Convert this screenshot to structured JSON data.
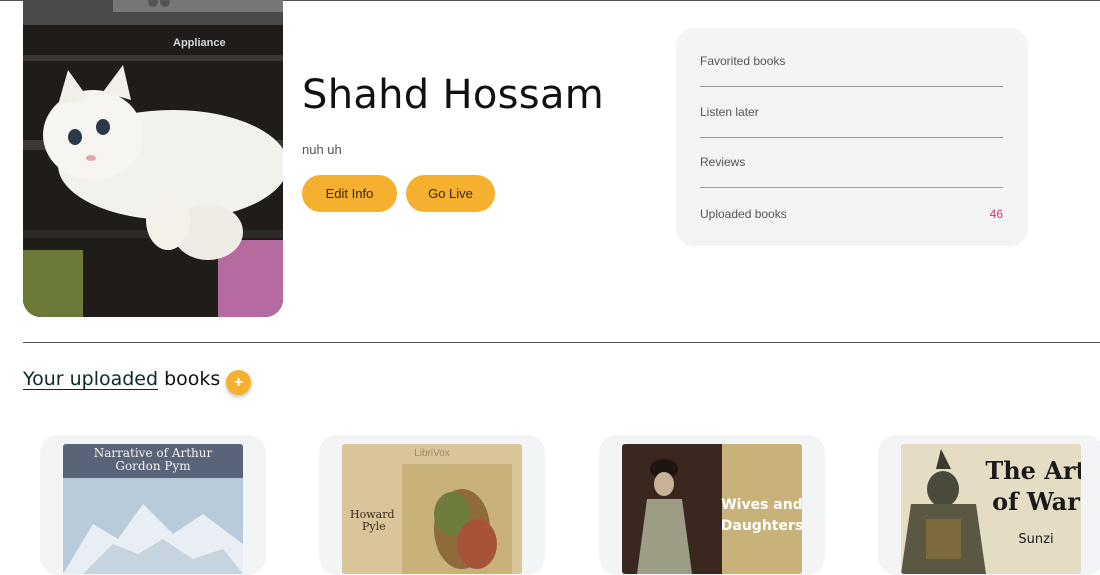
{
  "profile": {
    "name": "Shahd Hossam",
    "bio": "nuh uh",
    "edit_label": "Edit Info",
    "live_label": "Go Live",
    "photo_text": "Appliance"
  },
  "stats": {
    "favorited_label": "Favorited books",
    "listen_later_label": "Listen later",
    "reviews_label": "Reviews",
    "uploaded_label": "Uploaded books",
    "uploaded_count": "46"
  },
  "section": {
    "title_link": "Your uploaded",
    "title_rest": "books",
    "add_symbol": "+"
  },
  "books": [
    {
      "cover_title_1": "Narrative of Arthur",
      "cover_title_2": "Gordon Pym"
    },
    {
      "cover_top": "LibriVox",
      "author_1": "Howard",
      "author_2": "Pyle"
    },
    {
      "title_1": "Wives and",
      "title_2": "Daughters"
    },
    {
      "title_1": "The Art",
      "title_2": "of War",
      "author": "Sunzi"
    }
  ],
  "colors": {
    "accent": "#f4b02e",
    "card_bg": "#f3f4f6",
    "count": "#d6336c"
  }
}
